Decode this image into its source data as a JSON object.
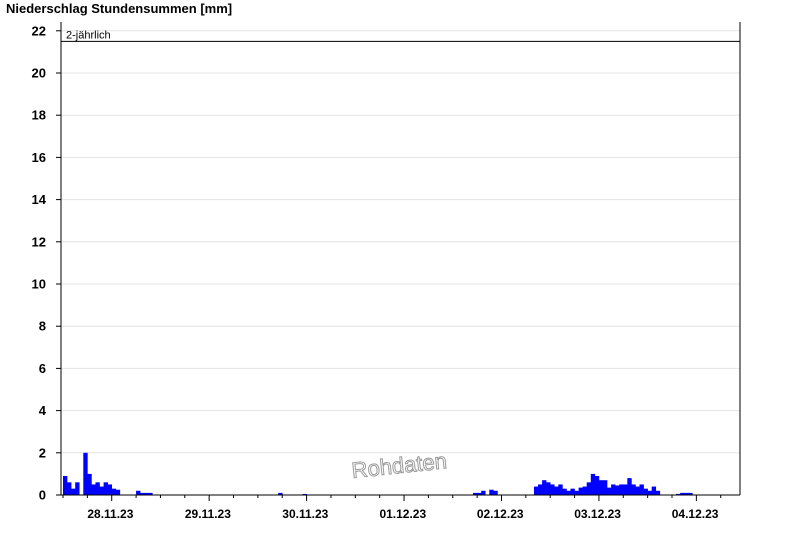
{
  "chart_data": {
    "type": "bar",
    "title": "Niederschlag Stundensummen [mm]",
    "xlabel": "",
    "ylabel": "",
    "ylim": [
      0,
      22.5
    ],
    "yticks": [
      0,
      2,
      4,
      6,
      8,
      10,
      12,
      14,
      16,
      18,
      20,
      22
    ],
    "grid": true,
    "start": "27.11.23 12:00",
    "interval_hours": 1,
    "x_tick_labels": [
      "28.11.23",
      "29.11.23",
      "30.11.23",
      "01.12.23",
      "02.12.23",
      "03.12.23",
      "04.12.23"
    ],
    "bar_color": "#0000ff",
    "reference_line": {
      "label": "2-jährlich",
      "value": 21.5
    },
    "watermark": "Rohdaten",
    "values": [
      0.9,
      0.6,
      0.3,
      0.6,
      0,
      2.0,
      1.0,
      0.5,
      0.6,
      0.4,
      0.6,
      0.5,
      0.3,
      0.25,
      0,
      0,
      0,
      0,
      0.2,
      0.1,
      0.1,
      0.1,
      0,
      0,
      0,
      0,
      0,
      0,
      0,
      0,
      0,
      0,
      0,
      0,
      0,
      0,
      0,
      0,
      0,
      0,
      0,
      0,
      0,
      0,
      0,
      0,
      0,
      0,
      0,
      0,
      0,
      0,
      0,
      0.1,
      0,
      0,
      0,
      0,
      0,
      0.05,
      0,
      0,
      0,
      0,
      0,
      0,
      0,
      0,
      0,
      0,
      0,
      0,
      0,
      0,
      0,
      0,
      0,
      0,
      0,
      0,
      0,
      0,
      0,
      0,
      0,
      0,
      0,
      0,
      0,
      0,
      0,
      0,
      0,
      0,
      0,
      0,
      0,
      0,
      0,
      0,
      0,
      0.1,
      0.1,
      0.2,
      0,
      0.25,
      0.2,
      0,
      0,
      0,
      0,
      0,
      0,
      0,
      0,
      0,
      0.4,
      0.5,
      0.7,
      0.6,
      0.5,
      0.4,
      0.5,
      0.3,
      0.2,
      0.3,
      0.2,
      0.35,
      0.4,
      0.6,
      1.0,
      0.9,
      0.7,
      0.7,
      0.35,
      0.5,
      0.45,
      0.5,
      0.5,
      0.8,
      0.5,
      0.4,
      0.5,
      0.3,
      0.2,
      0.4,
      0.2,
      0,
      0,
      0,
      0,
      0.05,
      0.1,
      0.1,
      0.1,
      0,
      0
    ]
  }
}
